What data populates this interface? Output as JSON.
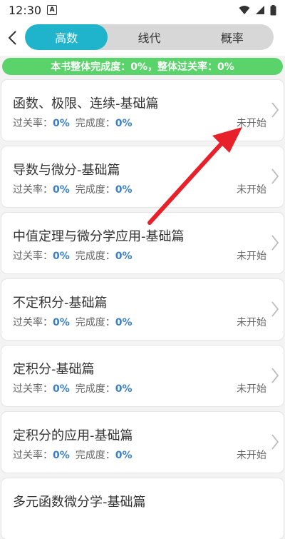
{
  "status_bar": {
    "time": "12:30",
    "notif_icon": "A"
  },
  "tabs": [
    {
      "label": "高数",
      "active": true
    },
    {
      "label": "线代",
      "active": false
    },
    {
      "label": "概率",
      "active": false
    }
  ],
  "banner": {
    "text": "本书整体完成度：0%，整体过关率：0%"
  },
  "labels": {
    "pass_rate": "过关率：",
    "completion": "完成度："
  },
  "chapters": [
    {
      "title": "函数、极限、连续-基础篇",
      "pass_rate": "0%",
      "completion": "0%",
      "status": "未开始"
    },
    {
      "title": "导数与微分-基础篇",
      "pass_rate": "0%",
      "completion": "0%",
      "status": "未开始"
    },
    {
      "title": "中值定理与微分学应用-基础篇",
      "pass_rate": "0%",
      "completion": "0%",
      "status": "未开始"
    },
    {
      "title": "不定积分-基础篇",
      "pass_rate": "0%",
      "completion": "0%",
      "status": "未开始"
    },
    {
      "title": "定积分-基础篇",
      "pass_rate": "0%",
      "completion": "0%",
      "status": "未开始"
    },
    {
      "title": "定积分的应用-基础篇",
      "pass_rate": "0%",
      "completion": "0%",
      "status": "未开始"
    },
    {
      "title": "多元函数微分学-基础篇",
      "pass_rate": "",
      "completion": "",
      "status": ""
    }
  ],
  "colors": {
    "accent": "#1fb3cc",
    "banner": "#5bd36b",
    "value": "#3b7fc4",
    "annotation_arrow": "#e8202a"
  }
}
